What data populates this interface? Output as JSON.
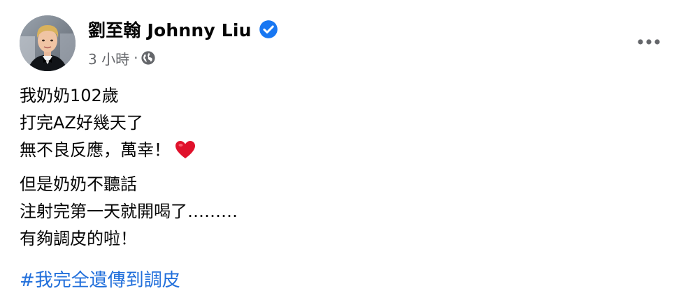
{
  "post": {
    "author": {
      "name": "劉至翰 Johnny Liu",
      "verified": true,
      "avatar_icon": "profile-photo"
    },
    "meta": {
      "time": "3 小時",
      "separator": "·",
      "audience_icon": "globe-icon"
    },
    "menu_icon": "more-options-icon",
    "paragraphs": [
      {
        "lines": [
          "我奶奶102歲",
          "打完AZ好幾天了",
          "無不良反應，萬幸！"
        ],
        "trailing_emoji": "heart"
      },
      {
        "lines": [
          "但是奶奶不聽話",
          "注射完第一天就開喝了………",
          "有夠調皮的啦！"
        ]
      }
    ],
    "hashtag": "#我完全遺傳到調皮"
  },
  "colors": {
    "text": "#050505",
    "secondary_text": "#65676b",
    "link": "#216fdb",
    "verified_badge": "#1877f2",
    "heart": "#e0112b"
  }
}
